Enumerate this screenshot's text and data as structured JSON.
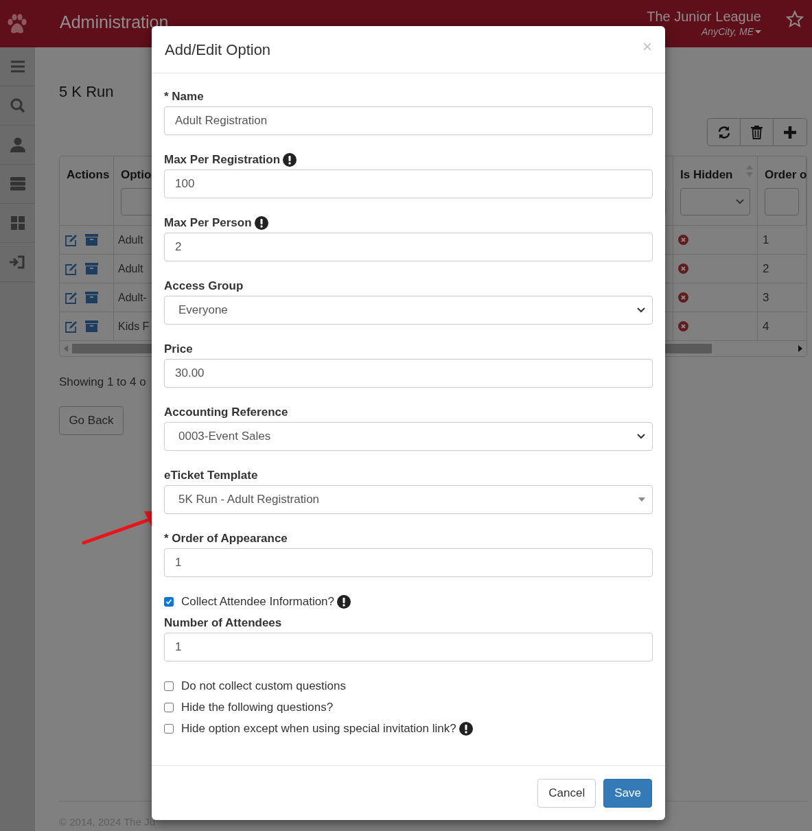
{
  "header": {
    "title": "Administration",
    "org": "The Junior League",
    "location": "AnyCity, ME"
  },
  "page": {
    "title": "5 K Run",
    "table": {
      "columns": [
        {
          "label": "Actions",
          "kind": "plain",
          "sortable": false
        },
        {
          "label": "Optio",
          "kind": "input",
          "sortable": false
        },
        {
          "label": "Is Hidden",
          "kind": "select",
          "sortable": true
        },
        {
          "label": "Order o",
          "kind": "input",
          "sortable": false
        }
      ],
      "rows": [
        {
          "option": "Adult",
          "is_hidden": false,
          "order": "1"
        },
        {
          "option": "Adult",
          "is_hidden": false,
          "order": "2"
        },
        {
          "option": "Adult-",
          "is_hidden": false,
          "order": "3"
        },
        {
          "option": "Kids F",
          "is_hidden": false,
          "order": "4"
        }
      ]
    },
    "summary": "Showing 1 to 4 o",
    "back_button": "Go Back",
    "footer": "© 2014, 2024 The Ju"
  },
  "modal": {
    "title": "Add/Edit Option",
    "close": "×",
    "fields": [
      {
        "kind": "text",
        "label": "* Name",
        "info": false,
        "value": "Adult Registration"
      },
      {
        "kind": "text",
        "label": "Max Per Registration",
        "info": true,
        "value": "100"
      },
      {
        "kind": "text",
        "label": "Max Per Person",
        "info": true,
        "value": "2"
      },
      {
        "kind": "select",
        "label": "Access Group",
        "info": false,
        "value": "Everyone"
      },
      {
        "kind": "text",
        "label": "Price",
        "info": false,
        "value": "30.00"
      },
      {
        "kind": "select",
        "label": "Accounting Reference",
        "info": false,
        "value": "0003-Event Sales"
      },
      {
        "kind": "combo",
        "label": "eTicket Template",
        "info": false,
        "value": "5K Run - Adult Registration"
      },
      {
        "kind": "text",
        "label": "* Order of Appearance",
        "info": false,
        "value": "1"
      },
      {
        "kind": "checkbox",
        "label": "Collect Attendee Information?",
        "info": true,
        "checked": true
      },
      {
        "kind": "text",
        "label": "Number of Attendees",
        "info": false,
        "value": "1"
      },
      {
        "kind": "checkbox",
        "label": "Do not collect custom questions",
        "info": false,
        "checked": false
      },
      {
        "kind": "checkbox",
        "label": "Hide the following questions?",
        "info": false,
        "checked": false
      },
      {
        "kind": "checkbox",
        "label": "Hide option except when using special invitation link?",
        "info": true,
        "checked": false
      }
    ],
    "cancel": "Cancel",
    "save": "Save"
  }
}
